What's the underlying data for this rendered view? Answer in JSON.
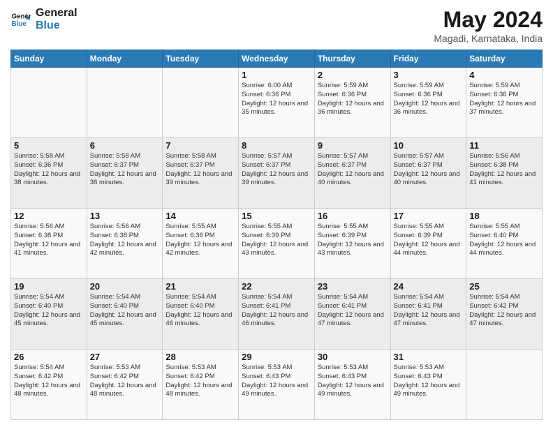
{
  "header": {
    "logo_line1": "General",
    "logo_line2": "Blue",
    "month_year": "May 2024",
    "location": "Magadi, Karnataka, India"
  },
  "weekdays": [
    "Sunday",
    "Monday",
    "Tuesday",
    "Wednesday",
    "Thursday",
    "Friday",
    "Saturday"
  ],
  "weeks": [
    [
      {
        "day": "",
        "info": ""
      },
      {
        "day": "",
        "info": ""
      },
      {
        "day": "",
        "info": ""
      },
      {
        "day": "1",
        "info": "Sunrise: 6:00 AM\nSunset: 6:36 PM\nDaylight: 12 hours\nand 35 minutes."
      },
      {
        "day": "2",
        "info": "Sunrise: 5:59 AM\nSunset: 6:36 PM\nDaylight: 12 hours\nand 36 minutes."
      },
      {
        "day": "3",
        "info": "Sunrise: 5:59 AM\nSunset: 6:36 PM\nDaylight: 12 hours\nand 36 minutes."
      },
      {
        "day": "4",
        "info": "Sunrise: 5:59 AM\nSunset: 6:36 PM\nDaylight: 12 hours\nand 37 minutes."
      }
    ],
    [
      {
        "day": "5",
        "info": "Sunrise: 5:58 AM\nSunset: 6:36 PM\nDaylight: 12 hours\nand 38 minutes."
      },
      {
        "day": "6",
        "info": "Sunrise: 5:58 AM\nSunset: 6:37 PM\nDaylight: 12 hours\nand 38 minutes."
      },
      {
        "day": "7",
        "info": "Sunrise: 5:58 AM\nSunset: 6:37 PM\nDaylight: 12 hours\nand 39 minutes."
      },
      {
        "day": "8",
        "info": "Sunrise: 5:57 AM\nSunset: 6:37 PM\nDaylight: 12 hours\nand 39 minutes."
      },
      {
        "day": "9",
        "info": "Sunrise: 5:57 AM\nSunset: 6:37 PM\nDaylight: 12 hours\nand 40 minutes."
      },
      {
        "day": "10",
        "info": "Sunrise: 5:57 AM\nSunset: 6:37 PM\nDaylight: 12 hours\nand 40 minutes."
      },
      {
        "day": "11",
        "info": "Sunrise: 5:56 AM\nSunset: 6:38 PM\nDaylight: 12 hours\nand 41 minutes."
      }
    ],
    [
      {
        "day": "12",
        "info": "Sunrise: 5:56 AM\nSunset: 6:38 PM\nDaylight: 12 hours\nand 41 minutes."
      },
      {
        "day": "13",
        "info": "Sunrise: 5:56 AM\nSunset: 6:38 PM\nDaylight: 12 hours\nand 42 minutes."
      },
      {
        "day": "14",
        "info": "Sunrise: 5:55 AM\nSunset: 6:38 PM\nDaylight: 12 hours\nand 42 minutes."
      },
      {
        "day": "15",
        "info": "Sunrise: 5:55 AM\nSunset: 6:39 PM\nDaylight: 12 hours\nand 43 minutes."
      },
      {
        "day": "16",
        "info": "Sunrise: 5:55 AM\nSunset: 6:39 PM\nDaylight: 12 hours\nand 43 minutes."
      },
      {
        "day": "17",
        "info": "Sunrise: 5:55 AM\nSunset: 6:39 PM\nDaylight: 12 hours\nand 44 minutes."
      },
      {
        "day": "18",
        "info": "Sunrise: 5:55 AM\nSunset: 6:40 PM\nDaylight: 12 hours\nand 44 minutes."
      }
    ],
    [
      {
        "day": "19",
        "info": "Sunrise: 5:54 AM\nSunset: 6:40 PM\nDaylight: 12 hours\nand 45 minutes."
      },
      {
        "day": "20",
        "info": "Sunrise: 5:54 AM\nSunset: 6:40 PM\nDaylight: 12 hours\nand 45 minutes."
      },
      {
        "day": "21",
        "info": "Sunrise: 5:54 AM\nSunset: 6:40 PM\nDaylight: 12 hours\nand 46 minutes."
      },
      {
        "day": "22",
        "info": "Sunrise: 5:54 AM\nSunset: 6:41 PM\nDaylight: 12 hours\nand 46 minutes."
      },
      {
        "day": "23",
        "info": "Sunrise: 5:54 AM\nSunset: 6:41 PM\nDaylight: 12 hours\nand 47 minutes."
      },
      {
        "day": "24",
        "info": "Sunrise: 5:54 AM\nSunset: 6:41 PM\nDaylight: 12 hours\nand 47 minutes."
      },
      {
        "day": "25",
        "info": "Sunrise: 5:54 AM\nSunset: 6:42 PM\nDaylight: 12 hours\nand 47 minutes."
      }
    ],
    [
      {
        "day": "26",
        "info": "Sunrise: 5:54 AM\nSunset: 6:42 PM\nDaylight: 12 hours\nand 48 minutes."
      },
      {
        "day": "27",
        "info": "Sunrise: 5:53 AM\nSunset: 6:42 PM\nDaylight: 12 hours\nand 48 minutes."
      },
      {
        "day": "28",
        "info": "Sunrise: 5:53 AM\nSunset: 6:42 PM\nDaylight: 12 hours\nand 48 minutes."
      },
      {
        "day": "29",
        "info": "Sunrise: 5:53 AM\nSunset: 6:43 PM\nDaylight: 12 hours\nand 49 minutes."
      },
      {
        "day": "30",
        "info": "Sunrise: 5:53 AM\nSunset: 6:43 PM\nDaylight: 12 hours\nand 49 minutes."
      },
      {
        "day": "31",
        "info": "Sunrise: 5:53 AM\nSunset: 6:43 PM\nDaylight: 12 hours\nand 49 minutes."
      },
      {
        "day": "",
        "info": ""
      }
    ]
  ]
}
